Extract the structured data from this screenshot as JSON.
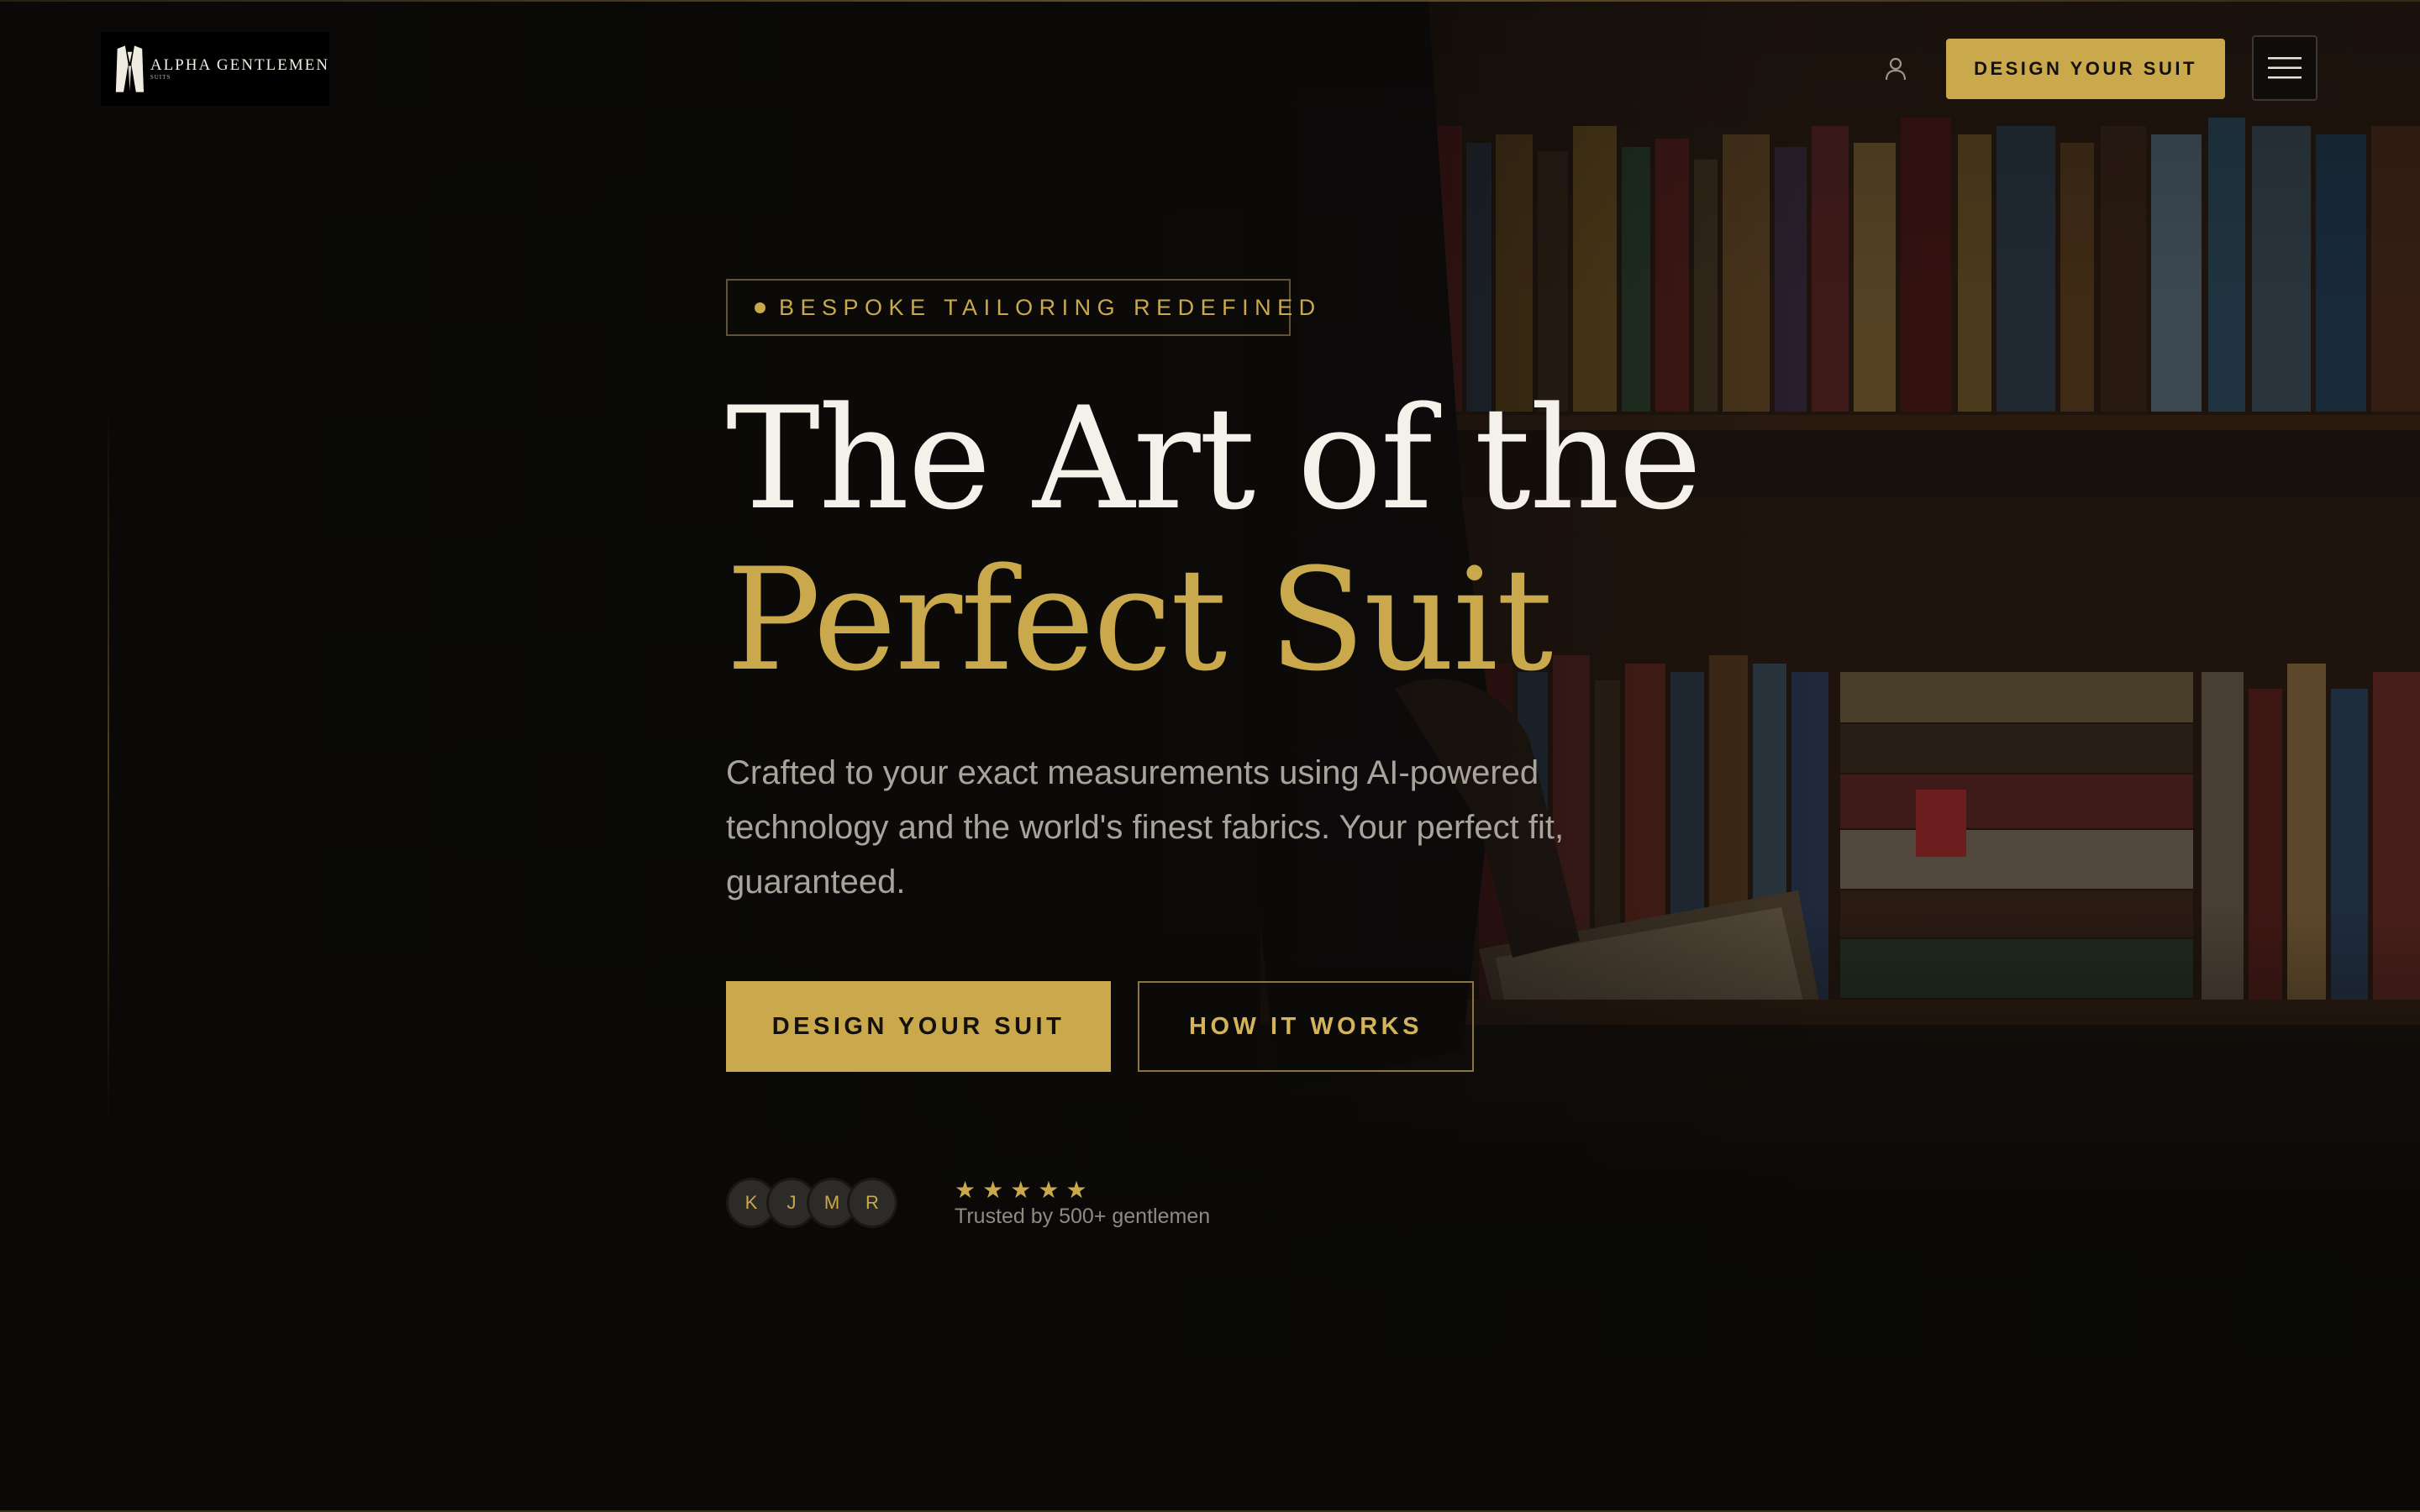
{
  "header": {
    "logo": {
      "name": "ALPHA GENTLEMEN",
      "sub": "SUITS"
    },
    "user_icon": "user-icon",
    "cta_label": "DESIGN YOUR SUIT",
    "menu_icon": "hamburger-menu-icon"
  },
  "hero": {
    "eyebrow": "BESPOKE TAILORING REDEFINED",
    "headline_line1": "The Art of the",
    "headline_line2": "Perfect Suit",
    "subtitle": "Crafted to your exact measurements using AI-powered technology and the world's finest fabrics. Your perfect fit, guaranteed.",
    "primary_button": "DESIGN YOUR SUIT",
    "secondary_button": "HOW IT WORKS",
    "avatars": [
      "K",
      "J",
      "M",
      "R"
    ],
    "star_count": 5,
    "star_icon": "star-icon",
    "trust_text": "Trusted by 500+ gentlemen"
  },
  "colors": {
    "background": "#0a0908",
    "gold": "#c9a94c",
    "text_primary": "#f4f1ea",
    "text_muted": "#a9a49b"
  }
}
